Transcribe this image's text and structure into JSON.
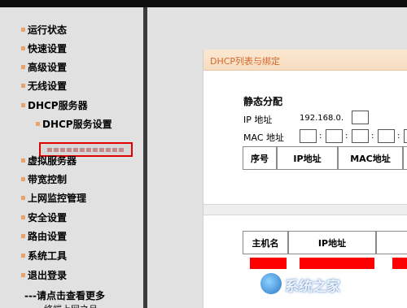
{
  "sidebar": {
    "items": [
      {
        "label": "运行状态"
      },
      {
        "label": "快速设置"
      },
      {
        "label": "高级设置"
      },
      {
        "label": "无线设置"
      },
      {
        "label": "DHCP服务器"
      },
      {
        "label": "DHCP服务设置"
      },
      {
        "label": "虚拟服务器"
      },
      {
        "label": "带宽控制"
      },
      {
        "label": "上网监控管理"
      },
      {
        "label": "安全设置"
      },
      {
        "label": "路由设置"
      },
      {
        "label": "系统工具"
      },
      {
        "label": "退出登录"
      }
    ],
    "more_link": "---请点击查看更多",
    "more_link_2": "终端上网之旦"
  },
  "panel": {
    "title": "DHCP列表与绑定",
    "static_section": "静态分配",
    "ip_label": "IP 地址",
    "ip_prefix": "192.168.0.",
    "mac_label": "MAC 地址",
    "mac_separators": [
      ":",
      ":",
      ":",
      ":"
    ],
    "table1_headers": [
      "序号",
      "IP地址",
      "MAC地址"
    ],
    "table2_headers": [
      "主机名",
      "IP地址"
    ]
  },
  "watermark": {
    "text": "系统之家"
  },
  "colors": {
    "bullet": "#e8a36d",
    "header_title": "#d1692b",
    "highlight_border": "#e00000",
    "redacted": "#ff0000"
  }
}
